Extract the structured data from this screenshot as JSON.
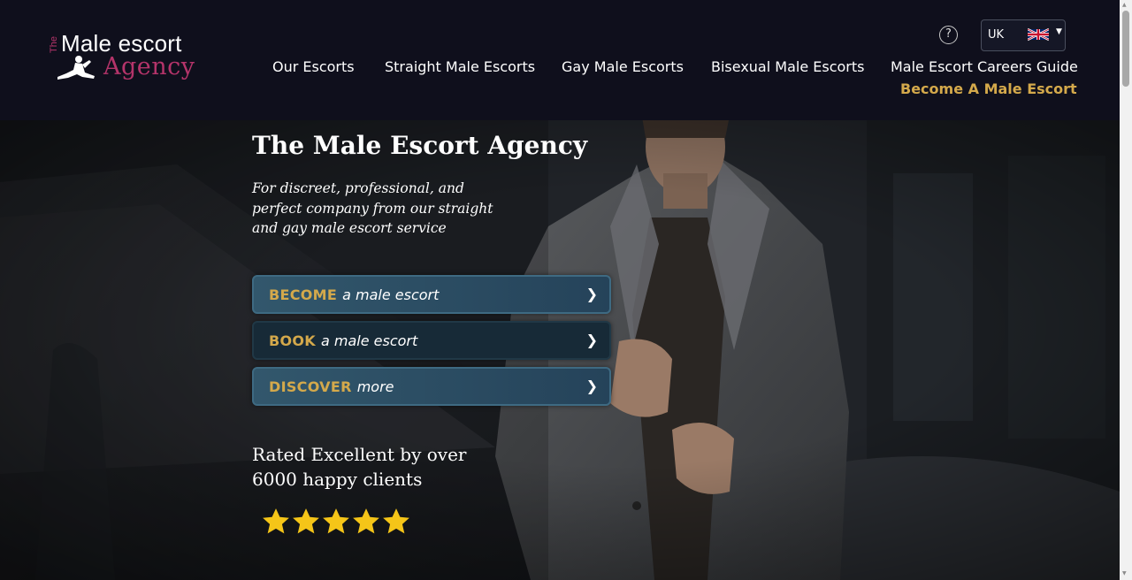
{
  "header": {
    "logo": {
      "the": "The",
      "line1": "Male escort",
      "line2": "Agency"
    },
    "help_label": "?",
    "language": {
      "code": "UK",
      "flag_icon": "uk-flag-icon"
    },
    "nav": [
      {
        "label": "Our Escorts"
      },
      {
        "label": "Straight Male Escorts"
      },
      {
        "label": "Gay Male Escorts"
      },
      {
        "label": "Bisexual Male Escorts"
      },
      {
        "label": "Male Escort Careers Guide"
      }
    ],
    "cta": "Become A Male Escort"
  },
  "hero": {
    "title": "The Male Escort Agency",
    "subtitle": "For discreet, professional, and perfect company from our straight and gay male escort service",
    "buttons": [
      {
        "keyword": "BECOME",
        "rest": "a male escort",
        "chevron": "❯"
      },
      {
        "keyword": "BOOK",
        "rest": "a male escort",
        "chevron": "❯"
      },
      {
        "keyword": "DISCOVER",
        "rest": "more",
        "chevron": "❯"
      }
    ],
    "rating_text": "Rated Excellent by over 6000 happy clients",
    "rating_stars": 5
  },
  "colors": {
    "header_bg": "#0f0f1c",
    "accent_gold": "#d4a94b",
    "brand_magenta": "#b5346a",
    "button_teal": "#32576c",
    "star_yellow": "#f5c518"
  }
}
